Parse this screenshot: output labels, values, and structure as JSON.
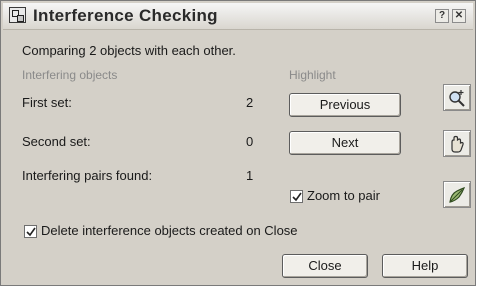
{
  "window": {
    "title": "Interference Checking",
    "help_glyph": "?",
    "close_glyph": "✕"
  },
  "summary": "Comparing 2 objects with each other.",
  "interfering_objects": {
    "heading": "Interfering objects",
    "first_set_label": "First set:",
    "first_set_value": "2",
    "second_set_label": "Second set:",
    "second_set_value": "0",
    "pairs_label": "Interfering pairs found:",
    "pairs_value": "1"
  },
  "highlight": {
    "heading": "Highlight",
    "previous_label": "Previous",
    "next_label": "Next",
    "zoom_label": "Zoom to pair",
    "zoom_checked": true
  },
  "side_icons": [
    "zoom-realtime-icon",
    "pan-icon",
    "orbit-icon"
  ],
  "delete_option": {
    "label": "Delete interference objects created on Close",
    "checked": true
  },
  "footer": {
    "close_label": "Close",
    "help_label": "Help"
  }
}
